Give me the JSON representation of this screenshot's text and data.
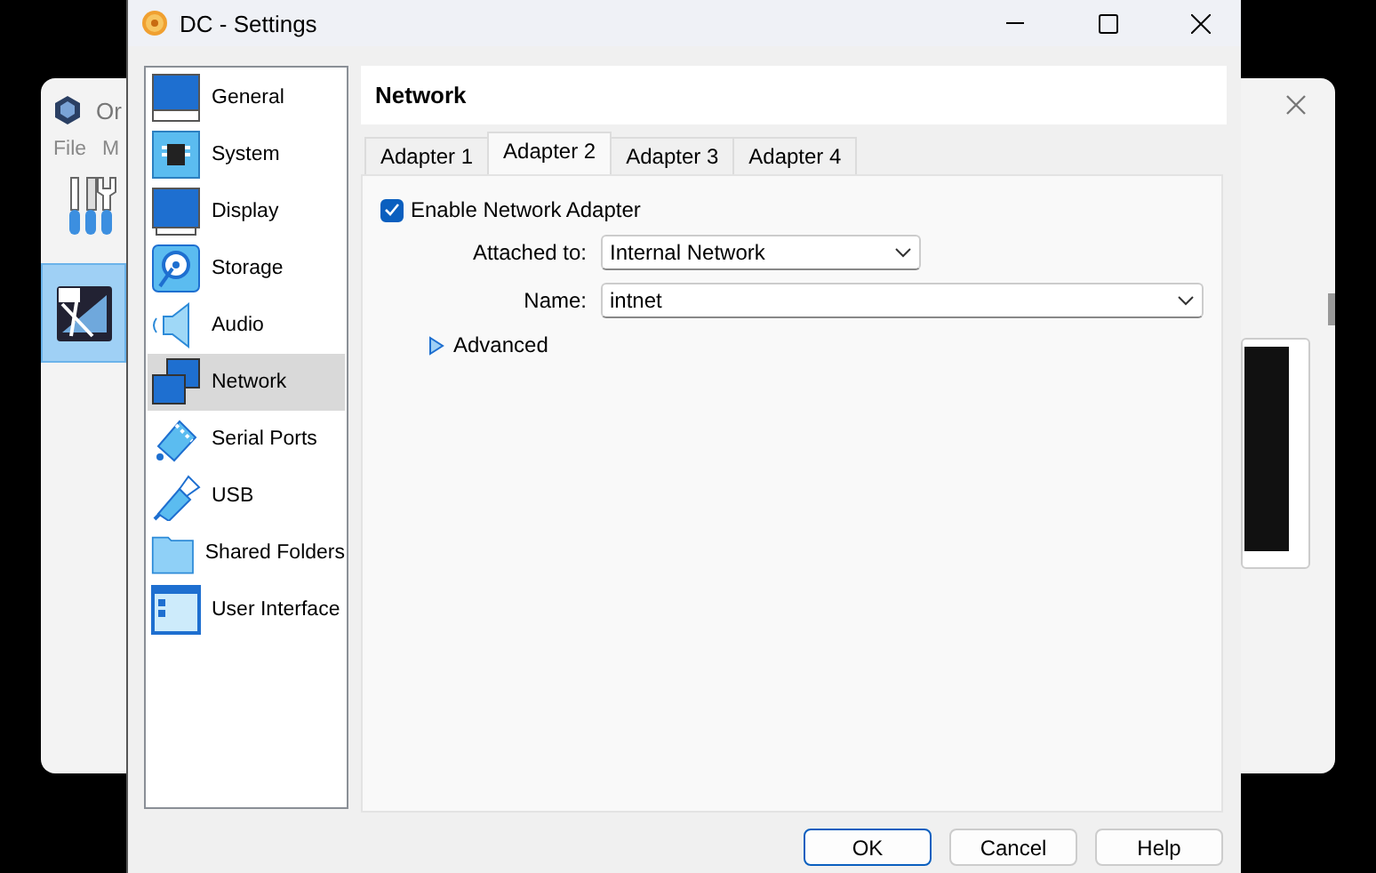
{
  "background_window": {
    "title": "Or",
    "menu": [
      "File",
      "M"
    ]
  },
  "window": {
    "title": "DC - Settings"
  },
  "sidebar": {
    "items": [
      {
        "label": "General",
        "kind": "general",
        "selected": false
      },
      {
        "label": "System",
        "kind": "system",
        "selected": false
      },
      {
        "label": "Display",
        "kind": "display",
        "selected": false
      },
      {
        "label": "Storage",
        "kind": "storage",
        "selected": false
      },
      {
        "label": "Audio",
        "kind": "audio",
        "selected": false
      },
      {
        "label": "Network",
        "kind": "network",
        "selected": true
      },
      {
        "label": "Serial Ports",
        "kind": "serial",
        "selected": false
      },
      {
        "label": "USB",
        "kind": "usb",
        "selected": false
      },
      {
        "label": "Shared Folders",
        "kind": "folder",
        "selected": false
      },
      {
        "label": "User Interface",
        "kind": "ui",
        "selected": false
      }
    ]
  },
  "page": {
    "title": "Network"
  },
  "tabs": [
    {
      "label": "Adapter 1",
      "selected": false
    },
    {
      "label": "Adapter 2",
      "selected": true
    },
    {
      "label": "Adapter 3",
      "selected": false
    },
    {
      "label": "Adapter 4",
      "selected": false
    }
  ],
  "enable_adapter": {
    "label": "Enable Network Adapter",
    "checked": true
  },
  "fields": [
    {
      "label": "Attached to:",
      "value": "Internal Network"
    },
    {
      "label": "Name:",
      "value": "intnet"
    }
  ],
  "advanced": {
    "label": "Advanced",
    "expanded": false
  },
  "buttons": [
    {
      "label": "OK",
      "focused": true
    },
    {
      "label": "Cancel",
      "focused": false
    },
    {
      "label": "Help",
      "focused": false
    }
  ]
}
